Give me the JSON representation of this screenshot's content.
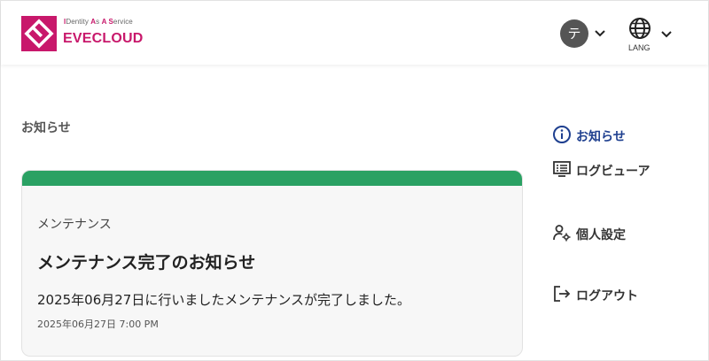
{
  "header": {
    "logo_tagline_parts": [
      "I",
      "Dentity ",
      "A",
      "s ",
      "A ",
      "S",
      "ervice"
    ],
    "logo_name": "EVECLOUD",
    "avatar_initial": "テ",
    "lang_label": "LANG"
  },
  "main": {
    "page_title": "お知らせ",
    "notice": {
      "category": "メンテナンス",
      "title": "メンテナンス完了のお知らせ",
      "body": "2025年06月27日に行いましたメンテナンスが完了しました。",
      "datetime": "2025年06月27日 7:00 PM",
      "accent_color": "#2aa163"
    }
  },
  "sidebar": {
    "items": [
      {
        "label": "お知らせ",
        "icon": "info-icon",
        "active": true
      },
      {
        "label": "ログビューア",
        "icon": "log-viewer-icon",
        "active": false
      },
      {
        "label": "個人設定",
        "icon": "user-settings-icon",
        "active": false
      },
      {
        "label": "ログアウト",
        "icon": "logout-icon",
        "active": false
      }
    ]
  },
  "colors": {
    "brand": "#c8186b",
    "active_nav": "#1e3f8f",
    "notice_bar": "#2aa163"
  }
}
